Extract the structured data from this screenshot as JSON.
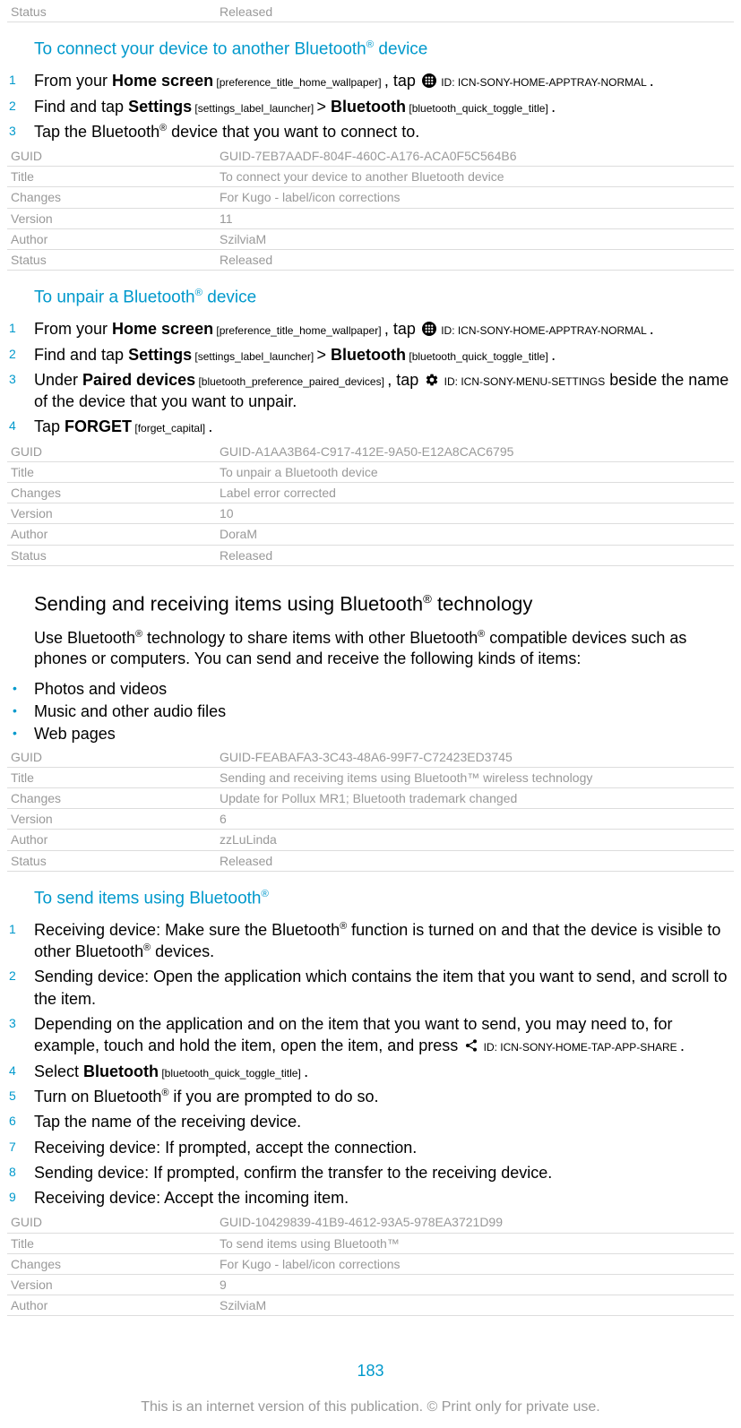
{
  "meta0": {
    "rows": [
      [
        "Status",
        "Released"
      ]
    ]
  },
  "section1": {
    "title_pre": "To connect your device to another Bluetooth",
    "title_suf": " device",
    "step1_a": "From your ",
    "step1_home": "Home screen",
    "step1_home_ann": " [preference_title_home_wallpaper] ",
    "step1_b": ", tap ",
    "step1_id": " ID: ICN-SONY-HOME-APPTRAY-NORMAL ",
    "step1_c": ".",
    "step2_a": "Find and tap ",
    "step2_settings": "Settings",
    "step2_settings_ann": " [settings_label_launcher] ",
    "step2_gt": "> ",
    "step2_bt": "Bluetooth",
    "step2_bt_ann": " [bluetooth_quick_toggle_title] ",
    "step2_c": ".",
    "step3_a": "Tap the Bluetooth",
    "step3_b": " device that you want to connect to."
  },
  "meta1": {
    "rows": [
      [
        "GUID",
        "GUID-7EB7AADF-804F-460C-A176-ACA0F5C564B6"
      ],
      [
        "Title",
        "To connect your device to another Bluetooth device"
      ],
      [
        "Changes",
        "For Kugo - label/icon corrections"
      ],
      [
        "Version",
        "11"
      ],
      [
        "Author",
        "SzilviaM"
      ],
      [
        "Status",
        "Released"
      ]
    ]
  },
  "section2": {
    "title_pre": "To unpair a Bluetooth",
    "title_suf": " device",
    "step3_a": "Under ",
    "step3_pd": "Paired devices",
    "step3_pd_ann": " [bluetooth_preference_paired_devices] ",
    "step3_b": ", tap ",
    "step3_id": " ID: ICN-SONY-MENU-SETTINGS",
    "step3_c": " beside the name of the device that you want to unpair.",
    "step4_a": "Tap ",
    "step4_forget": "FORGET",
    "step4_forget_ann": " [forget_capital] ",
    "step4_b": "."
  },
  "meta2": {
    "rows": [
      [
        "GUID",
        "GUID-A1AA3B64-C917-412E-9A50-E12A8CAC6795"
      ],
      [
        "Title",
        "To unpair a Bluetooth device"
      ],
      [
        "Changes",
        "Label error corrected"
      ],
      [
        "Version",
        "10"
      ],
      [
        "Author",
        "DoraM"
      ],
      [
        "Status",
        "Released"
      ]
    ]
  },
  "section3": {
    "title_pre": "Sending and receiving items using Bluetooth",
    "title_suf": " technology",
    "para_a": "Use Bluetooth",
    "para_b": " technology to share items with other Bluetooth",
    "para_c": " compatible devices such as phones or computers. You can send and receive the following kinds of items:",
    "b1": "Photos and videos",
    "b2": "Music and other audio files",
    "b3": "Web pages"
  },
  "meta3": {
    "rows": [
      [
        "GUID",
        "GUID-FEABAFA3-3C43-48A6-99F7-C72423ED3745"
      ],
      [
        "Title",
        "Sending and receiving items using Bluetooth™ wireless technology"
      ],
      [
        "Changes",
        "Update for Pollux MR1; Bluetooth trademark changed"
      ],
      [
        "Version",
        "6"
      ],
      [
        "Author",
        "zzLuLinda"
      ],
      [
        "Status",
        "Released"
      ]
    ]
  },
  "section4": {
    "title_pre": "To send items using Bluetooth",
    "step1_a": "Receiving device: Make sure the Bluetooth",
    "step1_b": " function is turned on and that the device is visible to other Bluetooth",
    "step1_c": " devices.",
    "step2": "Sending device: Open the application which contains the item that you want to send, and scroll to the item.",
    "step3_a": "Depending on the application and on the item that you want to send, you may need to, for example, touch and hold the item, open the item, and press ",
    "step3_id": " ID: ICN-SONY-HOME-TAP-APP-SHARE ",
    "step3_b": ".",
    "step4_a": "Select ",
    "step4_bt": "Bluetooth",
    "step4_bt_ann": " [bluetooth_quick_toggle_title] ",
    "step4_b": ".",
    "step5_a": "Turn on Bluetooth",
    "step5_b": " if you are prompted to do so.",
    "step6": "Tap the name of the receiving device.",
    "step7": "Receiving device: If prompted, accept the connection.",
    "step8": "Sending device: If prompted, confirm the transfer to the receiving device.",
    "step9": "Receiving device: Accept the incoming item."
  },
  "meta4": {
    "rows": [
      [
        "GUID",
        "GUID-10429839-41B9-4612-93A5-978EA3721D99"
      ],
      [
        "Title",
        "To send items using Bluetooth™"
      ],
      [
        "Changes",
        "For Kugo - label/icon corrections"
      ],
      [
        "Version",
        "9"
      ],
      [
        "Author",
        "SzilviaM"
      ]
    ]
  },
  "page_number": "183",
  "footer": "This is an internet version of this publication. © Print only for private use."
}
